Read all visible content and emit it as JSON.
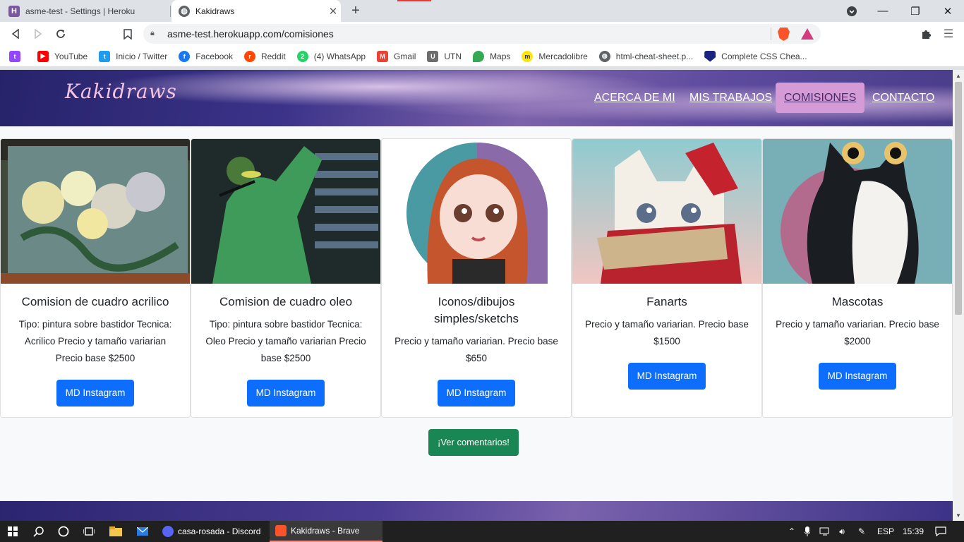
{
  "browser": {
    "tabs": [
      {
        "title": "asme-test - Settings | Heroku",
        "favicon": "heroku-icon"
      },
      {
        "title": "Kakidraws",
        "favicon": "globe-icon"
      }
    ],
    "url": "asme-test.herokuapp.com/comisiones",
    "bookmarks": [
      {
        "label": "",
        "icon": "twitch-icon",
        "color": "#9146ff"
      },
      {
        "label": "YouTube",
        "icon": "youtube-icon",
        "color": "#ff0000"
      },
      {
        "label": "Inicio / Twitter",
        "icon": "twitter-icon",
        "color": "#1d9bf0"
      },
      {
        "label": "Facebook",
        "icon": "facebook-icon",
        "color": "#1877f2"
      },
      {
        "label": "Reddit",
        "icon": "reddit-icon",
        "color": "#ff4500"
      },
      {
        "label": "(4) WhatsApp",
        "icon": "whatsapp-icon",
        "color": "#25d366"
      },
      {
        "label": "Gmail",
        "icon": "gmail-icon",
        "color": "#ea4335"
      },
      {
        "label": "UTN",
        "icon": "utn-icon",
        "color": "#6d6d6d"
      },
      {
        "label": "Maps",
        "icon": "maps-icon",
        "color": "#34a853"
      },
      {
        "label": "Mercadolibre",
        "icon": "mercadolibre-icon",
        "color": "#ffe600"
      },
      {
        "label": "html-cheat-sheet.p...",
        "icon": "globe-icon",
        "color": "#5f6368"
      },
      {
        "label": "Complete CSS Chea...",
        "icon": "shield-icon",
        "color": "#1a237e"
      }
    ]
  },
  "site": {
    "logo": "Kakidraws",
    "nav": [
      "ACERCA DE MI",
      "MIS TRABAJOS",
      "COMISIONES",
      "CONTACTO"
    ],
    "cards": [
      {
        "title": "Comision de cuadro acrilico",
        "desc": "Tipo: pintura sobre bastidor Tecnica: Acrilico Precio y tamaño variarian Precio base $2500",
        "button": "MD Instagram"
      },
      {
        "title": "Comision de cuadro oleo",
        "desc": "Tipo: pintura sobre bastidor Tecnica: Oleo Precio y tamaño variarian Precio base $2500",
        "button": "MD Instagram"
      },
      {
        "title": "Iconos/dibujos simples/sketchs",
        "desc": "Precio y tamaño variarian. Precio base $650",
        "button": "MD Instagram"
      },
      {
        "title": "Fanarts",
        "desc": "Precio y tamaño variarian. Precio base $1500",
        "button": "MD Instagram"
      },
      {
        "title": "Mascotas",
        "desc": "Precio y tamaño variarian. Precio base $2000",
        "button": "MD Instagram"
      }
    ],
    "comments_button": "¡Ver comentarios!"
  },
  "taskbar": {
    "apps": [
      {
        "label": "casa-rosada - Discord",
        "icon": "discord-icon",
        "color": "#5865f2"
      },
      {
        "label": "Kakidraws - Brave",
        "icon": "brave-icon",
        "color": "#fb542b"
      }
    ],
    "language": "ESP",
    "time": "15:39"
  }
}
